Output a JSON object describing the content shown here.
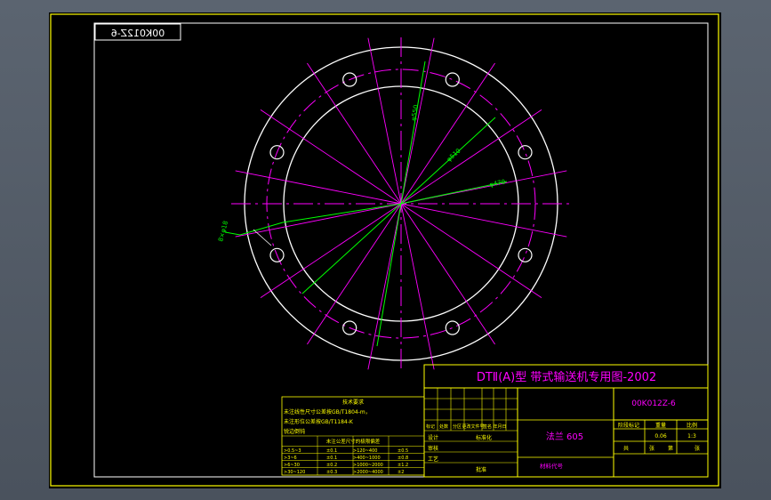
{
  "drawing": {
    "mirrored_code": "00K012Z-6",
    "bolt_hole_count": 8,
    "colors": {
      "frame": "#ffff00",
      "outline": "#ffffff",
      "center": "#ff00ff",
      "dimension": "#00ff00"
    }
  },
  "title_block": {
    "project": "DTⅡ(A)型  带式输送机专用图-2002",
    "drawing_code": "00K012Z-6",
    "part_name": "法兰 605",
    "part_note": "材料代号",
    "scale_value": "1:3",
    "weight_value": "0.06",
    "col_headers": [
      "标记",
      "处数",
      "分区",
      "更改文件号",
      "签名",
      "年月日"
    ],
    "role_labels": [
      "设计",
      "审核",
      "工艺"
    ],
    "standardize_label": "标准化",
    "approve_label": "批准",
    "stage_headers": [
      "阶段标记",
      "重量",
      "比例"
    ],
    "sheet_labels": [
      "共",
      "张",
      "第",
      "张"
    ]
  },
  "notes": {
    "title": "技术要求",
    "lines": [
      "未注线性尺寸公差按GB/T1804-m，",
      "未注形位公差按GB/T1184-K",
      "锐边倒钝"
    ],
    "tol_header": "未注公差尺寸的极限偏差",
    "tol_rows": [
      [
        ">0.5~3",
        "±0.1",
        ">120~400",
        "±0.5"
      ],
      [
        ">3~6",
        "±0.1",
        ">400~1000",
        "±0.8"
      ],
      [
        ">6~30",
        "±0.2",
        ">1000~2000",
        "±1.2"
      ],
      [
        ">30~120",
        "±0.3",
        ">2000~4000",
        "±2"
      ]
    ]
  },
  "dimensions": [
    "φ550",
    "φ510",
    "φ470",
    "8×φ18"
  ]
}
